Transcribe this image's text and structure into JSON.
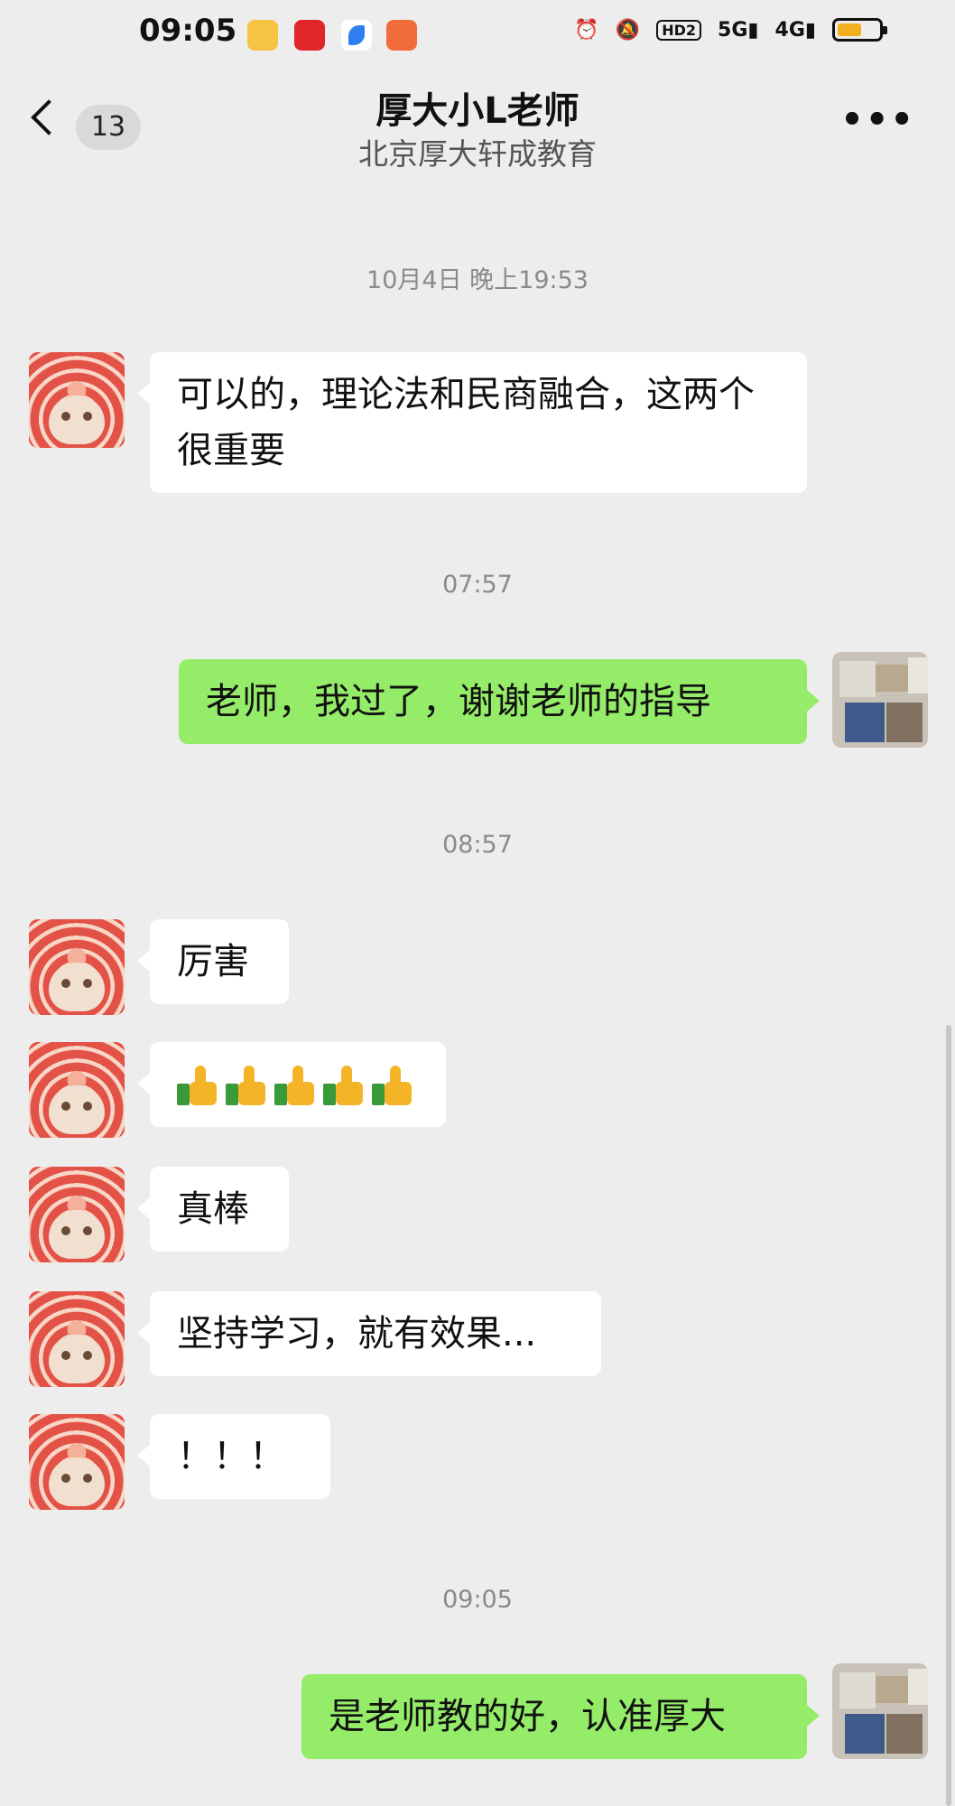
{
  "status_bar": {
    "time": "09:05",
    "icons": [
      "toutiao-app-icon",
      "pinduoduo-app-icon",
      "feather-app-icon",
      "reader-app-icon",
      "alarm-icon",
      "mute-icon",
      "hd2-icon",
      "5g-signal-icon",
      "4g-signal-icon",
      "battery-icon"
    ],
    "hd_label": "HD2",
    "net1": "5G",
    "net2": "4G",
    "battery_color": "#f2b01e"
  },
  "nav": {
    "unread_count": "13",
    "title": "厚大小L老师",
    "subtitle": "北京厚大轩成教育"
  },
  "messages": [
    {
      "type": "time",
      "text": "10月4日 晚上19:53"
    },
    {
      "type": "msg",
      "side": "left",
      "text": "可以的，理论法和民商融合，这两个很重要"
    },
    {
      "type": "time",
      "text": "07:57"
    },
    {
      "type": "msg",
      "side": "right",
      "text": "老师，我过了，谢谢老师的指导"
    },
    {
      "type": "time",
      "text": "08:57"
    },
    {
      "type": "msg",
      "side": "left",
      "text": "厉害"
    },
    {
      "type": "msg",
      "side": "left",
      "emoji": "thumbs-up",
      "count": 5
    },
    {
      "type": "msg",
      "side": "left",
      "text": "真棒"
    },
    {
      "type": "msg",
      "side": "left",
      "text": "坚持学习，就有效果..."
    },
    {
      "type": "msg",
      "side": "left",
      "text": "！！！"
    },
    {
      "type": "time",
      "text": "09:05"
    },
    {
      "type": "msg",
      "side": "right",
      "text": "是老师教的好，认准厚大"
    }
  ],
  "colors": {
    "background": "#ededed",
    "bubble_self": "#95ec69",
    "bubble_other": "#ffffff"
  }
}
